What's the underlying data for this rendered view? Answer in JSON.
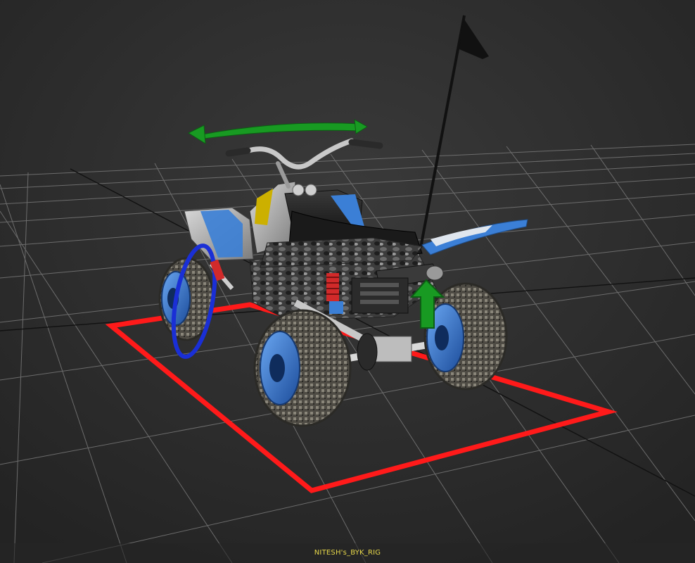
{
  "viewport": {
    "background": "#2a2a2a",
    "grid_color": "#7a7a7a",
    "grid_axis_color": "#111111",
    "caption": "NITESH's_BYK_RIG",
    "caption_color": "#e8d84a"
  },
  "scene": {
    "object": "atv-quad-bike-rig",
    "controls": [
      {
        "name": "root-control",
        "shape": "rectangle",
        "color": "#ff1a1a"
      },
      {
        "name": "steering-control",
        "shape": "curved-arrow",
        "color": "#1fa31f"
      },
      {
        "name": "suspension-control",
        "shape": "up-arrow",
        "color": "#1fa31f"
      },
      {
        "name": "wheel-spin-control",
        "shape": "ring",
        "color": "#1a2fd6"
      }
    ],
    "colors": {
      "body_blue": "#3b7fd6",
      "tire": "#5a574f",
      "rim": "#2e67c4",
      "spring": "#d12a2a",
      "frame": "#c8c8c8"
    }
  }
}
